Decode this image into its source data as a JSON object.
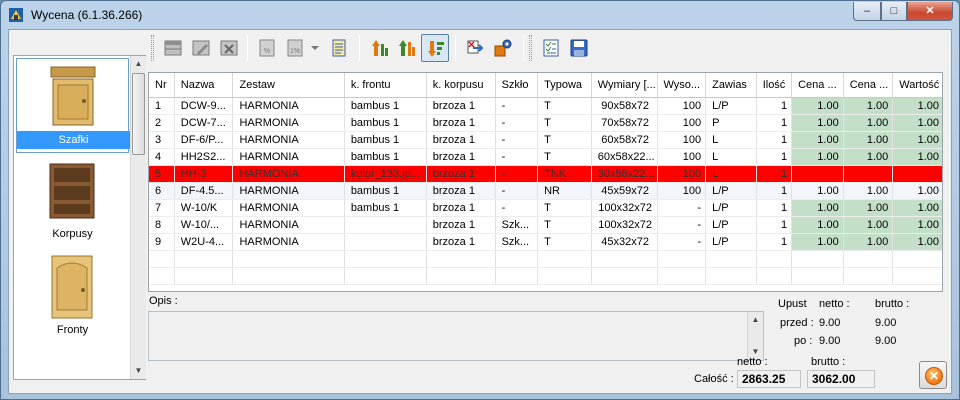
{
  "window": {
    "title": "Wycena (6.1.36.266)"
  },
  "titlebar_buttons": {
    "minimize": "–",
    "maximize": "□",
    "close": "✕"
  },
  "categories": [
    {
      "label": "Szafki",
      "selected": true
    },
    {
      "label": "Korpusy",
      "selected": false
    },
    {
      "label": "Fronty",
      "selected": false
    }
  ],
  "toolbar": {
    "buttons": [
      "add-row-icon",
      "edit-row-icon",
      "delete-row-icon",
      "percent-icon",
      "percent-discount-icon",
      "notes-icon",
      "sort-up-icon",
      "sort-numeric-icon",
      "sort-down-icon",
      "recalculate-icon",
      "settings-icon",
      "checklist-icon",
      "save-icon"
    ]
  },
  "table": {
    "columns": [
      "Nr",
      "Nazwa",
      "Zestaw",
      "k. frontu",
      "k. korpusu",
      "Szkło",
      "Typowa",
      "Wymiary [...",
      "Wyso...",
      "Zawias",
      "Ilość",
      "Cena ...",
      "Cena ...",
      "Wartość"
    ],
    "rows": [
      [
        "1",
        "DCW-9...",
        "HARMONIA",
        "bambus 1",
        "brzoza 1",
        "-",
        "T",
        "90x58x72",
        "100",
        "L/P",
        "1",
        "1.00",
        "1.00",
        "1.00"
      ],
      [
        "2",
        "DCW-7...",
        "HARMONIA",
        "bambus 1",
        "brzoza 1",
        "-",
        "T",
        "70x58x72",
        "100",
        "P",
        "1",
        "1.00",
        "1.00",
        "1.00"
      ],
      [
        "3",
        "DF-6/P...",
        "HARMONIA",
        "bambus 1",
        "brzoza 1",
        "-",
        "T",
        "60x58x72",
        "100",
        "L",
        "1",
        "1.00",
        "1.00",
        "1.00"
      ],
      [
        "4",
        "HH2S2...",
        "HARMONIA",
        "bambus 1",
        "brzoza 1",
        "-",
        "T",
        "60x58x22...",
        "100",
        "L",
        "1",
        "1.00",
        "1.00",
        "1.00"
      ],
      [
        "5",
        "HH-3",
        "HARMONIA",
        "kolor_133.jp...",
        "brzoza 1",
        "-",
        "TNK",
        "30x58x22...",
        "100",
        "L",
        "1",
        "",
        "",
        ""
      ],
      [
        "6",
        "DF-4.5...",
        "HARMONIA",
        "bambus 1",
        "brzoza 1",
        "-",
        "NR",
        "45x59x72",
        "100",
        "L/P",
        "1",
        "1.00",
        "1.00",
        "1.00"
      ],
      [
        "7",
        "W-10/K",
        "HARMONIA",
        "bambus 1",
        "brzoza 1",
        "-",
        "T",
        "100x32x72",
        "-",
        "L/P",
        "1",
        "1.00",
        "1.00",
        "1.00"
      ],
      [
        "8",
        "W-10/...",
        "HARMONIA",
        "",
        "brzoza 1",
        "Szk...",
        "T",
        "100x32x72",
        "-",
        "L/P",
        "1",
        "1.00",
        "1.00",
        "1.00"
      ],
      [
        "9",
        "W2U-4...",
        "HARMONIA",
        "",
        "brzoza 1",
        "Szk...",
        "T",
        "45x32x72",
        "-",
        "L/P",
        "1",
        "1.00",
        "1.00",
        "1.00"
      ]
    ],
    "row_states": [
      "",
      "",
      "",
      "",
      "error",
      "current",
      "",
      "",
      ""
    ],
    "colors": {
      "error_row": "#ff0000",
      "price_cell": "#c3dfc8"
    }
  },
  "opis": {
    "label": "Opis :",
    "value": ""
  },
  "upust": {
    "title": "Upust",
    "netto_header": "netto :",
    "brutto_header": "brutto :",
    "przed_label": "przed :",
    "przed_netto": "9.00",
    "przed_brutto": "9.00",
    "po_label": "po :",
    "po_netto": "9.00",
    "po_brutto": "9.00"
  },
  "totals": {
    "label": "Całość :",
    "netto_header": "netto :",
    "brutto_header": "brutto :",
    "netto": "2863.25",
    "brutto": "3062.00"
  },
  "close_button": {
    "icon": "close-circle-icon"
  }
}
